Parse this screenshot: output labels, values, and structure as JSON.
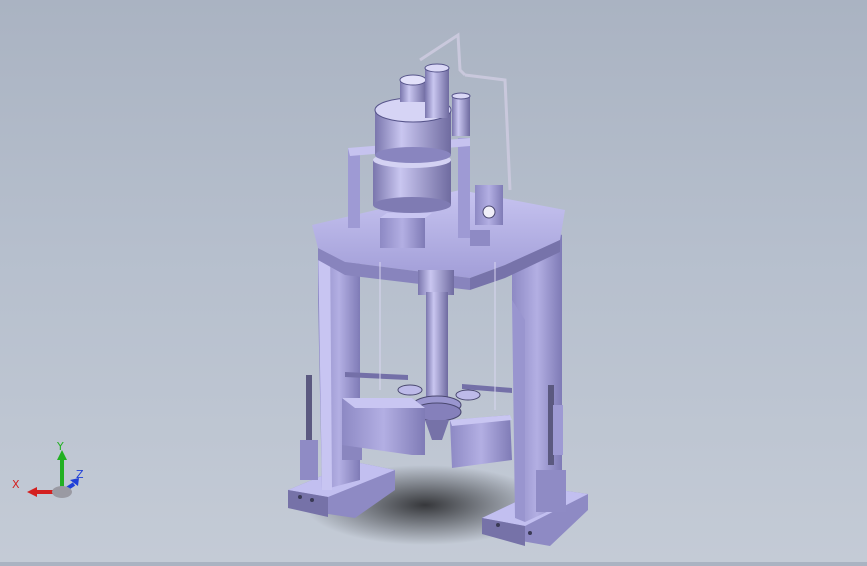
{
  "viewport": {
    "background_top": "#aab3c2",
    "background_bottom": "#c4cbd6",
    "model_color": "#a39fd6",
    "model_shadow": "#5f5d86"
  },
  "triad": {
    "x_label": "X",
    "y_label": "Y",
    "z_label": "Z",
    "x_color": "#d42020",
    "y_color": "#22b022",
    "z_color": "#1f3fd8"
  }
}
